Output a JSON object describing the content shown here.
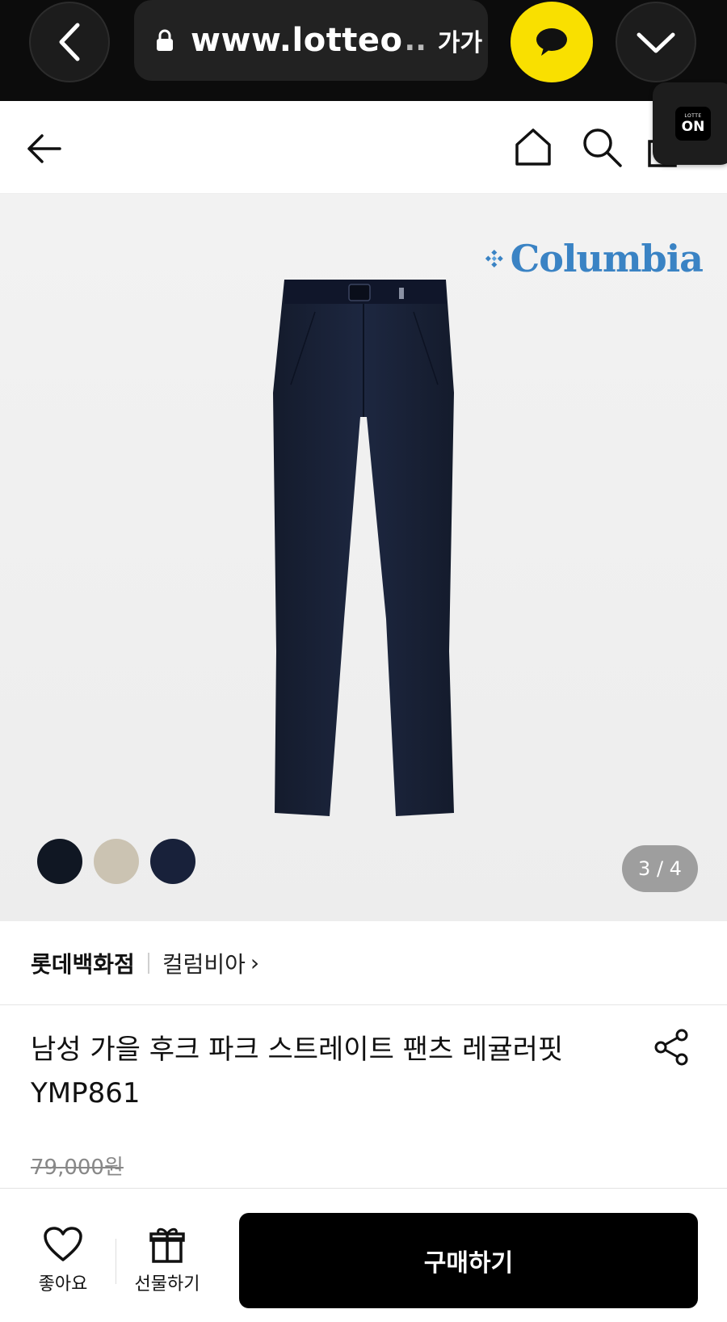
{
  "browser": {
    "url": "www.lotteo",
    "url_ellipsis": "..",
    "font_size_label": "가가"
  },
  "badge": {
    "small": "LOTTE",
    "label": "ON"
  },
  "product_image": {
    "brand_logo": "Columbia",
    "page_indicator": "3 / 4",
    "swatches": [
      "#101723",
      "#cbc3b2",
      "#18213a"
    ]
  },
  "store": {
    "name": "롯데백화점",
    "brand": "컬럼비아",
    "chevron": "›"
  },
  "product": {
    "title": "남성 가을 후크 파크 스트레이트 팬츠 레귤러핏 YMP861",
    "original_price": "79,000원"
  },
  "bottom_bar": {
    "like_label": "좋아요",
    "gift_label": "선물하기",
    "buy_label": "구매하기"
  },
  "colors": {
    "kakao": "#f9e000",
    "brand_blue": "#3a83c4",
    "buy_button": "#000000"
  }
}
